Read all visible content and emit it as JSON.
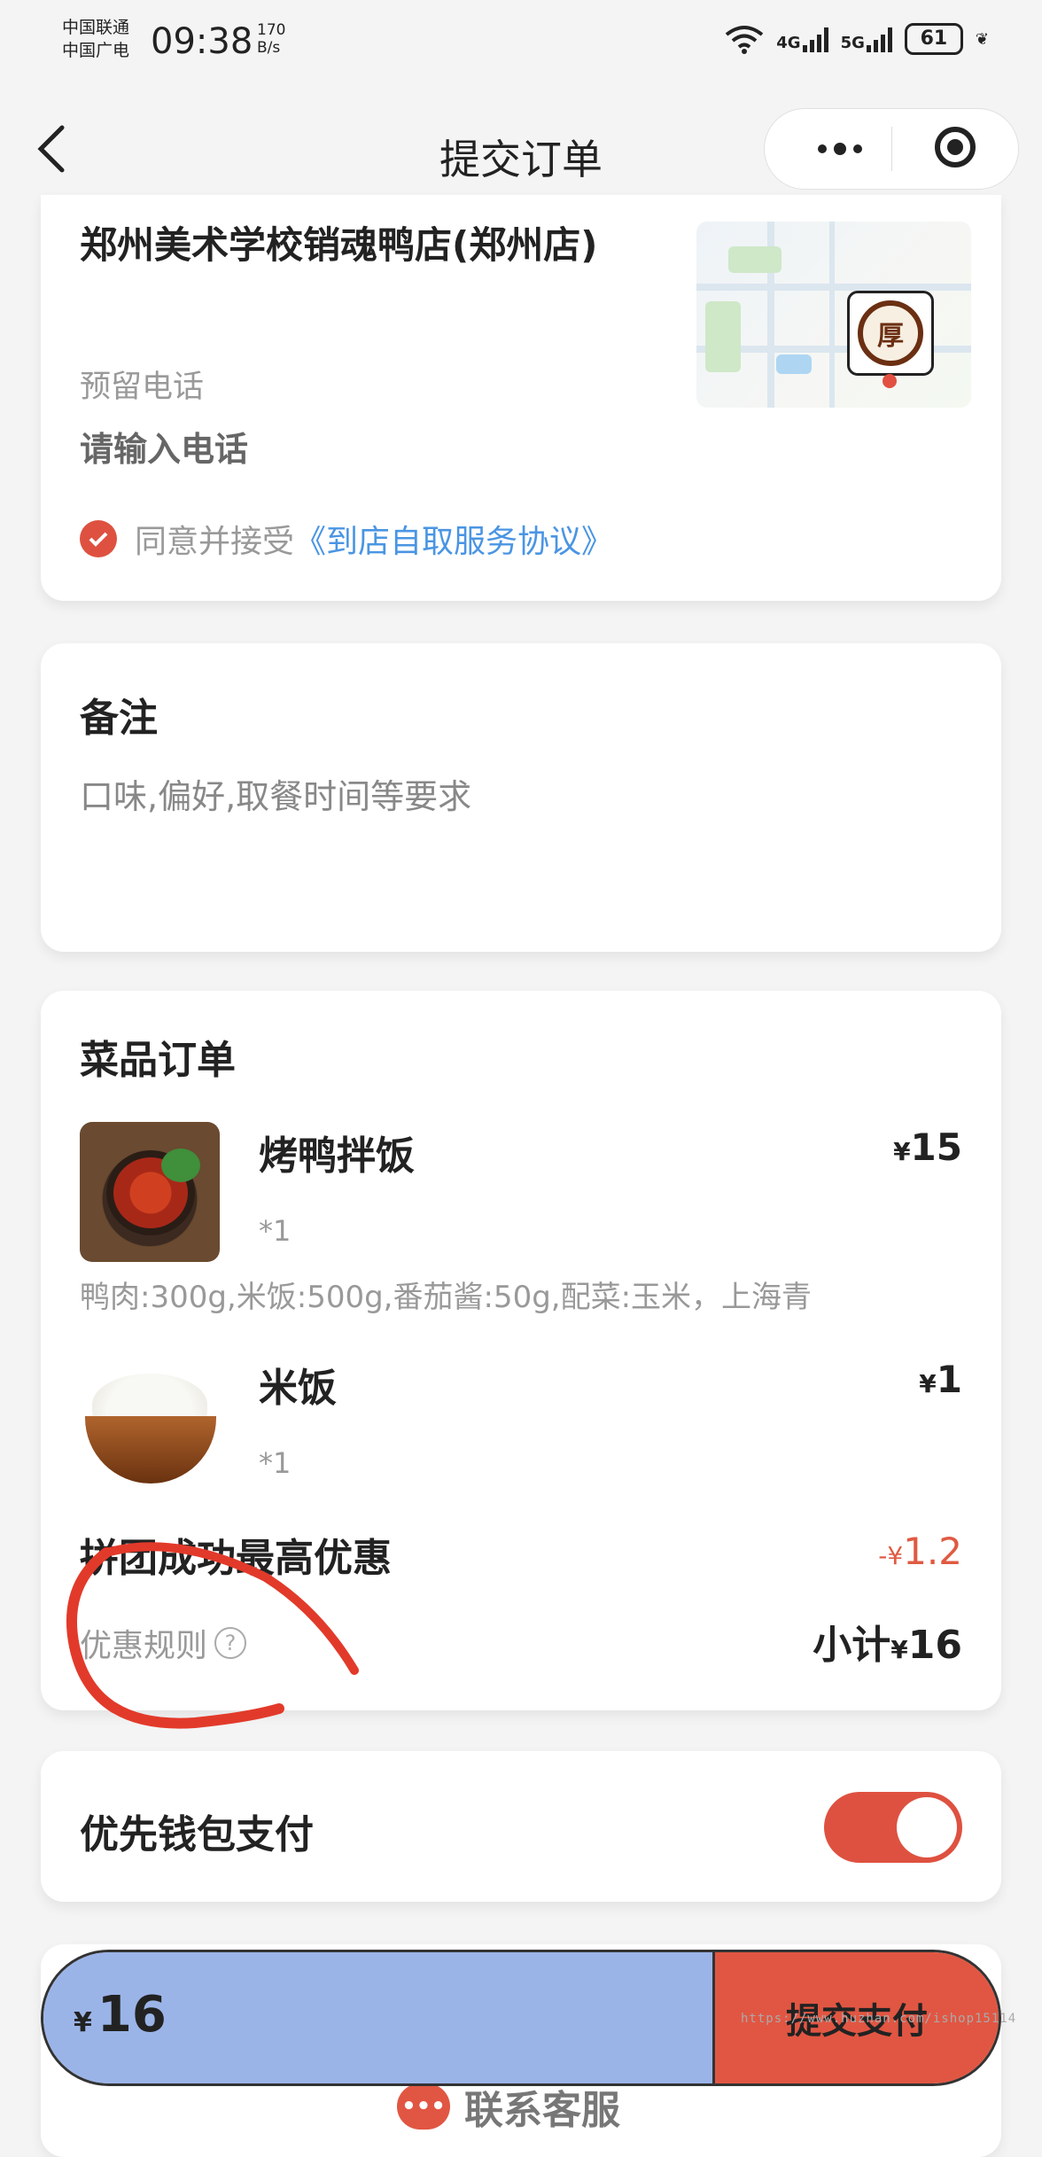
{
  "status_bar": {
    "carrier1": "中国联通",
    "carrier2": "中国广电",
    "time": "09:38",
    "speed_value": "170",
    "speed_unit": "B/s",
    "net1": "4G",
    "net2": "5G",
    "battery": "61"
  },
  "nav": {
    "back_icon": "chevron-left-icon",
    "title": "提交订单"
  },
  "store": {
    "name": "郑州美术学校销魂鸭店(郑州店)",
    "map_logo_text": "厚",
    "phone_label": "预留电话",
    "phone_placeholder": "请输入电话",
    "agree_checked": true,
    "agree_text": "同意并接受",
    "agree_link": "《到店自取服务协议》"
  },
  "remark": {
    "title": "备注",
    "placeholder": "口味,偏好,取餐时间等要求"
  },
  "order": {
    "title": "菜品订单",
    "items": [
      {
        "name": "烤鸭拌饭",
        "qty": "*1",
        "currency": "¥",
        "price": "15",
        "spec": "鸭肉:300g,米饭:500g,番茄酱:50g,配菜:玉米，上海青"
      },
      {
        "name": "米饭",
        "qty": "*1",
        "currency": "¥",
        "price": "1"
      }
    ],
    "promo_title": "拼团成功最高优惠",
    "discount_prefix": "-",
    "discount_currency": "¥",
    "discount_value": "1.2",
    "rules_label": "优惠规则",
    "subtotal_label": "小计",
    "subtotal_currency": "¥",
    "subtotal_value": "16"
  },
  "wallet": {
    "label": "优先钱包支付",
    "enabled": true
  },
  "pay_bar": {
    "currency": "¥",
    "total": "16",
    "submit_label": "提交支付"
  },
  "watermark": "https://www.huzhan.com/ishop15114",
  "service": {
    "label": "联系客服"
  },
  "colors": {
    "accent": "#de5140",
    "link": "#4a95e3",
    "pay_total_bg": "#9bb4e8",
    "annotation": "#e23a2a"
  }
}
